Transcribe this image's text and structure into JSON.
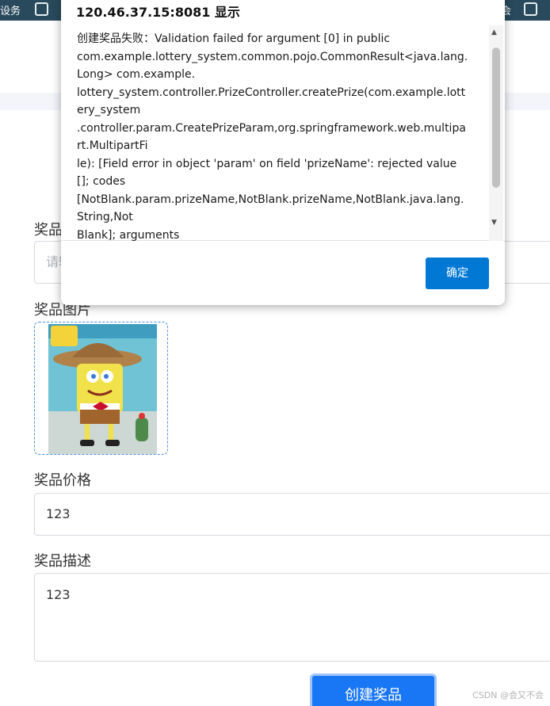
{
  "browser_bar": {
    "left_text": "设务",
    "right_text": "会"
  },
  "form": {
    "name_label": "奖品",
    "name_placeholder": "请输",
    "image_label": "奖品图片",
    "price_label": "奖品价格",
    "price_value": "123",
    "desc_label": "奖品描述",
    "desc_value": "123",
    "submit_label": "创建奖品"
  },
  "dialog": {
    "title": "120.46.37.15:8081 显示",
    "message": "创建奖品失败：Validation failed for argument [0] in public\ncom.example.lottery_system.common.pojo.CommonResult<java.lang.\nLong> com.example.\nlottery_system.controller.PrizeController.createPrize(com.example.lott\nery_system\n.controller.param.CreatePrizeParam,org.springframework.web.multipa\nrt.MultipartFi\nle): [Field error in object 'param' on field 'prizeName': rejected value\n[]; codes\n[NotBlank.param.prizeName,NotBlank.prizeName,NotBlank.java.lang.\nString,Not\nBlank]; arguments",
    "ok_label": "确定"
  },
  "watermark": "CSDN @会又不会"
}
